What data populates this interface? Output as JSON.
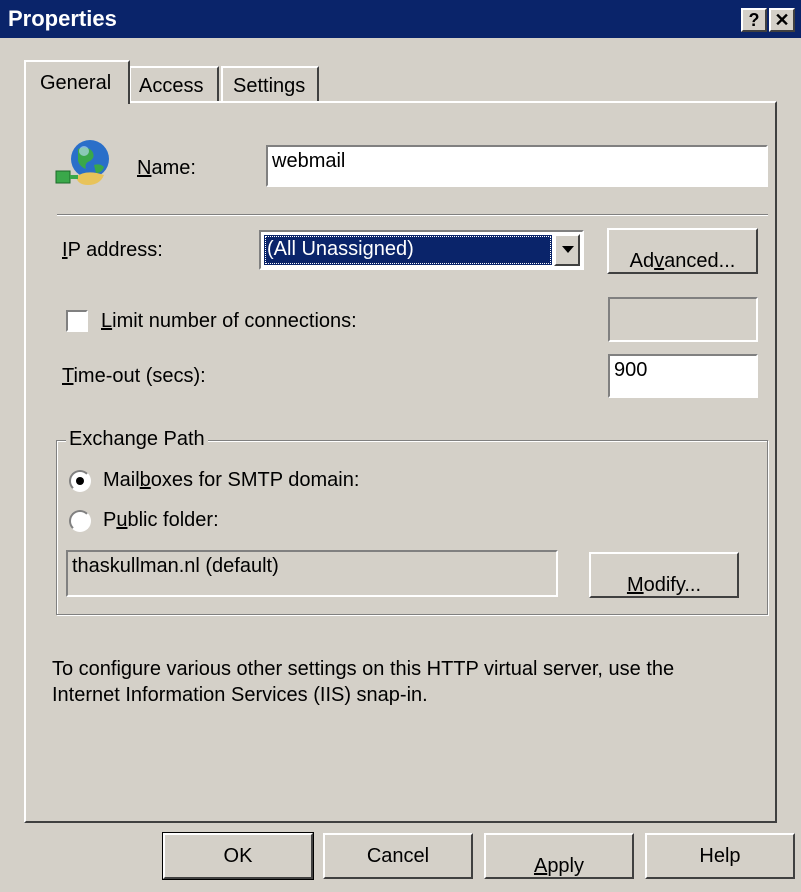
{
  "window": {
    "title": "Properties",
    "help_glyph": "?",
    "close_glyph": "✕"
  },
  "tabs": [
    {
      "label": "General",
      "active": true
    },
    {
      "label": "Access",
      "active": false
    },
    {
      "label": "Settings",
      "active": false
    }
  ],
  "general": {
    "name": {
      "label_prefix": "",
      "label_mnemonic": "N",
      "label_suffix": "ame:",
      "value": "webmail"
    },
    "ip": {
      "label_mnemonic": "I",
      "label_suffix": "P address:",
      "value": "(All Unassigned)"
    },
    "advanced_button": {
      "prefix": "Ad",
      "mnemonic": "v",
      "suffix": "anced..."
    },
    "limit_connections": {
      "mnemonic": "L",
      "suffix": "imit number of connections:",
      "checked": false,
      "value": ""
    },
    "timeout": {
      "mnemonic": "T",
      "suffix": "ime-out (secs):",
      "value": "900"
    },
    "exchange_path": {
      "title": "Exchange Path",
      "mailboxes": {
        "prefix": "Mail",
        "mnemonic": "b",
        "suffix": "oxes for SMTP domain:",
        "checked": true
      },
      "public_folder": {
        "prefix": "P",
        "mnemonic": "u",
        "suffix": "blic folder:",
        "checked": false
      },
      "path_value": "thaskullman.nl (default)",
      "modify_button": {
        "mnemonic": "M",
        "suffix": "odify..."
      }
    },
    "info_line1": "To configure various other settings on this HTTP virtual server, use the",
    "info_line2": "Internet Information Services (IIS) snap-in."
  },
  "footer": {
    "ok": "OK",
    "cancel": "Cancel",
    "apply": {
      "mnemonic": "A",
      "suffix": "pply"
    },
    "help": "Help"
  }
}
